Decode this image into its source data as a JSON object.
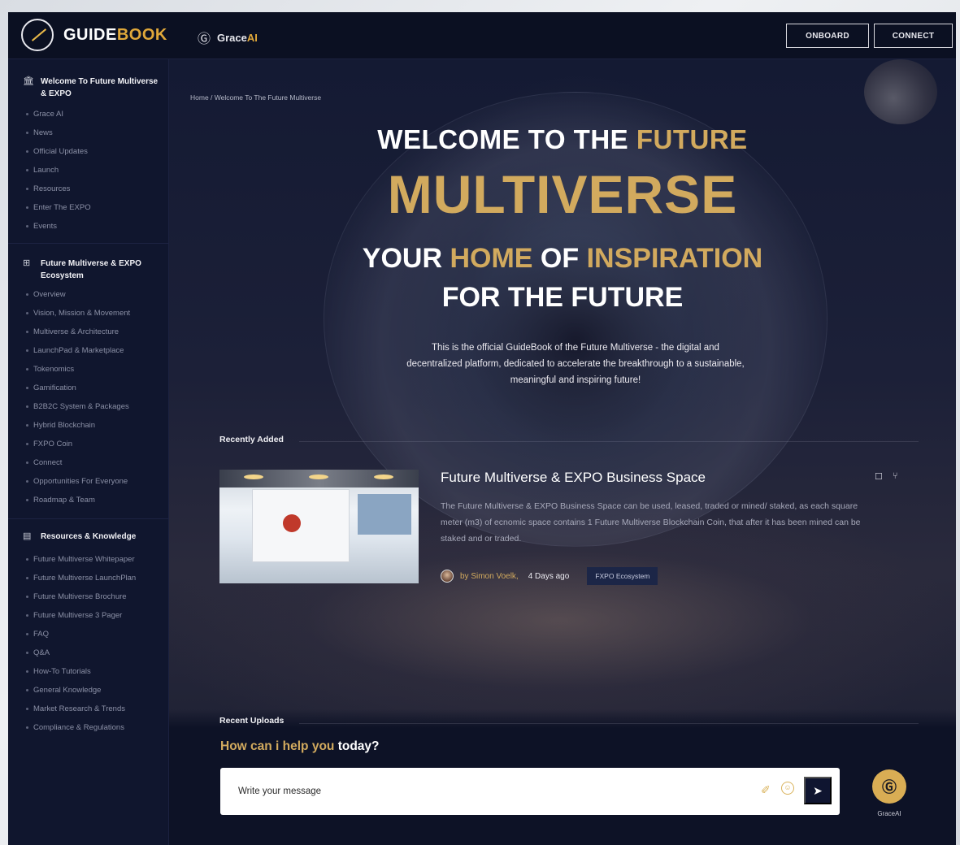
{
  "header": {
    "logo_white": "GUIDE",
    "logo_gold": "BOOK",
    "grace_label": "Grace",
    "grace_ai": "AI",
    "onboard": "ONBOARD",
    "connect": "CONNECT"
  },
  "sidebar": {
    "sections": [
      {
        "title": "Welcome To Future Multiverse & EXPO",
        "icon": "building-icon",
        "items": [
          "Grace AI",
          "News",
          "Official Updates",
          "Launch",
          "Resources",
          "Enter The EXPO",
          "Events"
        ]
      },
      {
        "title": "Future Multiverse & EXPO Ecosystem",
        "icon": "network-icon",
        "items": [
          "Overview",
          "Vision, Mission & Movement",
          "Multiverse & Architecture",
          "LaunchPad & Marketplace",
          "Tokenomics",
          "Gamification",
          "B2B2C System & Packages",
          "Hybrid Blockchain",
          "FXPO Coin",
          "Connect",
          "Opportunities For Everyone",
          "Roadmap & Team"
        ]
      },
      {
        "title": "Resources & Knowledge",
        "icon": "book-icon",
        "items": [
          "Future Multiverse Whitepaper",
          "Future Multiverse LaunchPlan",
          "Future Multiverse Brochure",
          "Future Multiverse 3 Pager",
          "FAQ",
          "Q&A",
          "How-To Tutorials",
          "General Knowledge",
          "Market Research & Trends",
          "Compliance & Regulations"
        ]
      }
    ]
  },
  "main": {
    "breadcrumb": "Home / Welcome To The Future Multiverse",
    "hero": {
      "line1_white": "WELCOME TO THE ",
      "line1_gold": "FUTURE",
      "line2": "MULTIVERSE",
      "line3_a": "YOUR ",
      "line3_b": "HOME",
      "line3_c": " OF ",
      "line3_d": "INSPIRATION",
      "line4": "FOR THE FUTURE",
      "description": "This is the official GuideBook of the Future Multiverse - the digital and decentralized platform, dedicated to accelerate the breakthrough to a sustainable, meaningful and inspiring future!"
    },
    "recently_added_label": "Recently Added",
    "card": {
      "title": "Future Multiverse & EXPO Business Space",
      "description": "The Future Multiverse & EXPO Business Space can be used, leased, traded or mined/ staked, as each square meter (m3) of ecnomic space contains 1 Future Multiverse Blockchain Coin, that after it has been mined can be staked and or traded.",
      "author": "by Simon Voelk,",
      "age": "4 Days ago",
      "tag": "FXPO Ecosystem"
    },
    "recent_uploads_label": "Recent Uploads",
    "chat": {
      "prompt_gold": "How can i help you ",
      "prompt_white": "today?",
      "placeholder": "Write your message",
      "fab_label": "GraceAI"
    }
  },
  "colors": {
    "accent_gold": "#d2aa5e",
    "background": "#0d1226",
    "sidebar": "#10162e"
  }
}
